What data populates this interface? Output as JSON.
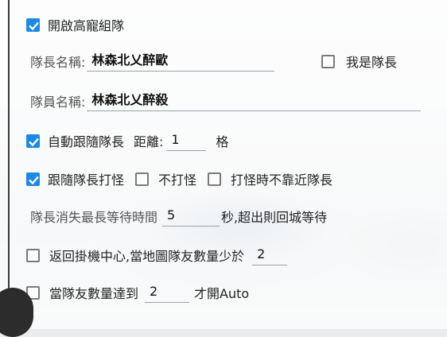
{
  "enable_group": {
    "label": "開啟高寵組隊",
    "checked": true
  },
  "leader_name": {
    "label": "隊長名稱:",
    "value": "林森北乂醉歐"
  },
  "i_am_leader": {
    "label": "我是隊長",
    "checked": false
  },
  "member_name": {
    "label": "隊員名稱:",
    "value": "林森北乂醉殺"
  },
  "auto_follow": {
    "label": "自動跟隨隊長",
    "checked": true,
    "distance_label": "距離:",
    "distance_value": "1",
    "unit": "格"
  },
  "follow_fight": {
    "label": "跟隨隊長打怪",
    "checked": true
  },
  "no_fight": {
    "label": "不打怪",
    "checked": false
  },
  "no_approach": {
    "label": "打怪時不靠近隊長",
    "checked": false
  },
  "leader_missing": {
    "label": "隊長消失最長等待時間",
    "value": "5",
    "suffix": "秒,超出則回城等待"
  },
  "return_center": {
    "label": "返回掛機中心,當地圖隊友數量少於",
    "value": "2",
    "checked": false
  },
  "team_count": {
    "label": "當隊友數量達到",
    "value": "2",
    "suffix": "才開Auto",
    "checked": false
  }
}
